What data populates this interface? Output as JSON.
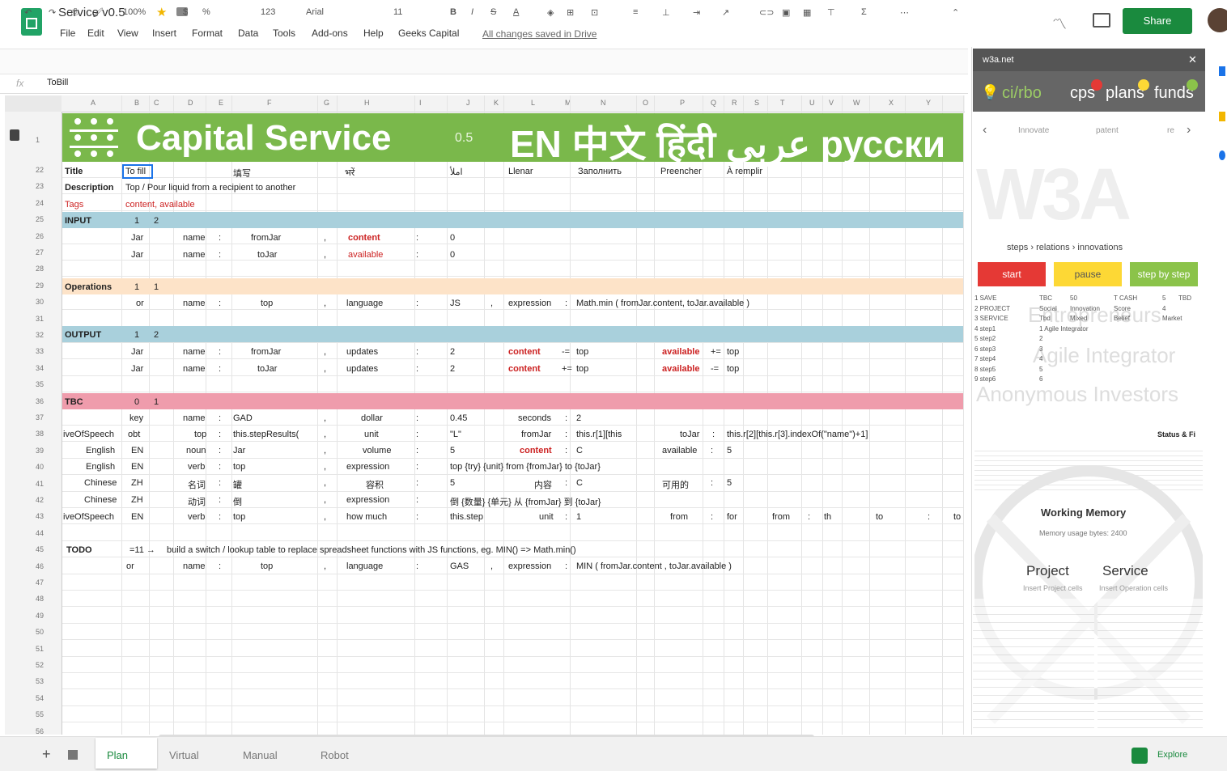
{
  "app": {
    "doc_title": "Service v0.5",
    "menu": [
      "File",
      "Edit",
      "View",
      "Insert",
      "Format",
      "Data",
      "Tools",
      "Add-ons",
      "Help",
      "Geeks Capital"
    ],
    "saved_status": "All changes saved in Drive",
    "share_label": "Share"
  },
  "toolbar": {
    "zoom": "100%",
    "font": "Arial",
    "font_size": "11",
    "format_num": "123"
  },
  "formula": {
    "value": "ToBill"
  },
  "banner": {
    "title": "Capital Service",
    "version": "0.5",
    "langs": "EN 中文 हिंदी عربي русски"
  },
  "grid": {
    "col_headers": [
      "A",
      "B",
      "C",
      "D",
      "E",
      "F",
      "G",
      "H",
      "I",
      "J",
      "K",
      "L",
      "M",
      "N",
      "O",
      "P",
      "Q",
      "R",
      "S",
      "T",
      "U",
      "V",
      "W",
      "X",
      "Y"
    ],
    "row_numbers": [
      "1",
      "22",
      "23",
      "24",
      "25",
      "26",
      "27",
      "28",
      "29",
      "30",
      "31",
      "32",
      "33",
      "34",
      "35",
      "36",
      "37",
      "38",
      "39",
      "40",
      "41",
      "42",
      "43",
      "44",
      "45",
      "46",
      "47",
      "48",
      "49",
      "50",
      "51",
      "52",
      "53",
      "54",
      "55",
      "56"
    ],
    "rows": {
      "r22": [
        "Title",
        "To fill",
        "填写",
        "भरें",
        "املأ",
        "Llenar",
        "Заполнить",
        "Preencher",
        "À remplir"
      ],
      "r23": [
        "Description",
        "Top / Pour liquid from a recipient to another"
      ],
      "r24": [
        "Tags",
        "content, available"
      ],
      "r25": [
        "INPUT",
        "1",
        "2"
      ],
      "r26": [
        "Jar",
        "name",
        ":",
        "fromJar",
        ",",
        "content",
        ":",
        "0"
      ],
      "r27": [
        "Jar",
        "name",
        ":",
        "toJar",
        ",",
        "available",
        ":",
        "0"
      ],
      "r29": [
        "Operations",
        "1",
        "1"
      ],
      "r30": [
        "or",
        "name",
        ":",
        "top",
        ",",
        "language",
        ":",
        "JS",
        ",",
        "expression",
        ":",
        "Math.min ( fromJar.content, toJar.available )"
      ],
      "r32": [
        "OUTPUT",
        "1",
        "2"
      ],
      "r33": [
        "Jar",
        "name",
        ":",
        "fromJar",
        ",",
        "updates",
        ":",
        "2",
        "content",
        "-=",
        "top",
        "available",
        "+=",
        "top"
      ],
      "r34": [
        "Jar",
        "name",
        ":",
        "toJar",
        ",",
        "updates",
        ":",
        "2",
        "content",
        "+=",
        "top",
        "available",
        "-=",
        "top"
      ],
      "r36": [
        "TBC",
        "0",
        "1"
      ],
      "r37": [
        "key",
        "name",
        ":",
        "GAD",
        ",",
        "dollar",
        ":",
        "0.45",
        "seconds",
        ":",
        "2"
      ],
      "r38": [
        "iveOfSpeech",
        "obt",
        "top",
        ":",
        "this.stepResults(",
        ",",
        "unit",
        ":",
        "\"L\"",
        "fromJar",
        ":",
        "this.r[1][this",
        "toJar",
        ":",
        "this.r[2][this.r[3].indexOf(\"name\")+1]"
      ],
      "r39": [
        "English",
        "EN",
        "noun",
        ":",
        "Jar",
        ",",
        "volume",
        ":",
        "5",
        "content",
        ":",
        "C",
        "available",
        ":",
        "5"
      ],
      "r40": [
        "English",
        "EN",
        "verb",
        ":",
        "top",
        ",",
        "expression",
        ":",
        "top {try} {unit} from {fromJar} to {toJar}"
      ],
      "r41": [
        "Chinese",
        "ZH",
        "名词",
        ":",
        "罐",
        ",",
        "容积",
        ":",
        "5",
        "内容",
        ":",
        "C",
        "可用的",
        ":",
        "5"
      ],
      "r42": [
        "Chinese",
        "ZH",
        "动词",
        ":",
        "倒",
        ",",
        "expression",
        ":",
        "倒 {数量} {单元} 从 {fromJar} 到 {toJar}"
      ],
      "r43": [
        "iveOfSpeech",
        "EN",
        "verb",
        ":",
        "top",
        ",",
        "how much",
        ":",
        "this.step",
        "unit",
        ":",
        "1",
        "from",
        ":",
        "for",
        "from",
        ":",
        "th",
        "to",
        ":",
        "to"
      ],
      "r45": [
        "TODO",
        "=11 →",
        "build a switch / lookup table to replace spreadsheet functions with JS functions, eg. MIN() => Math.min()"
      ],
      "r46": [
        "or",
        "name",
        ":",
        "top",
        ",",
        "language",
        ":",
        "GAS",
        ",",
        "expression",
        ":",
        "MIN ( fromJar.content , toJar.available )"
      ]
    }
  },
  "sidebar": {
    "header": "w3a.net",
    "tabs": [
      "ci/rbo",
      "cps",
      "plans",
      "funds"
    ],
    "nav_items": [
      "Innovate",
      "patent",
      "re"
    ],
    "watermark_text": "W3A",
    "steps_crumb": "steps › relations › innovations",
    "buttons": {
      "start": "start",
      "pause": "pause",
      "step": "step by step"
    },
    "mini_rows": [
      [
        "1 SAVE",
        "TBC",
        "50",
        "T CASH",
        "5",
        "TBD"
      ],
      [
        "2 PROJECT",
        "Social",
        "Innovation",
        "Score",
        "4",
        ""
      ],
      [
        "3 SERVICE",
        "Tbd",
        "Mixed",
        "Belief",
        "Market",
        ""
      ],
      [
        "4 step1",
        "1 Agile Integrator",
        "",
        "",
        "",
        ""
      ],
      [
        "5 step2",
        "2",
        "",
        "",
        "",
        ""
      ],
      [
        "6 step3",
        "3",
        "",
        "",
        "",
        ""
      ],
      [
        "7 step4",
        "4",
        "",
        "",
        "",
        ""
      ],
      [
        "8 step5",
        "5",
        "",
        "",
        "",
        ""
      ],
      [
        "9 step6",
        "6",
        "",
        "",
        "",
        ""
      ]
    ],
    "overlay_words": [
      "Entrepreneurs",
      "Agile Integrator",
      "Anonymous Investors"
    ],
    "status_label": "Status & Fi",
    "working_memory": "Working Memory",
    "memory_usage": "Memory usage bytes: 2400",
    "project_label": "Project",
    "project_sub": "Insert Project cells",
    "service_label": "Service",
    "service_sub": "Insert Operation cells"
  },
  "bottom": {
    "sheets": [
      "Plan",
      "Virtual",
      "Manual",
      "Robot"
    ],
    "active_sheet": "Plan",
    "explore_label": "Explore"
  },
  "colors": {
    "banner": "#7ab84b",
    "blue_band": "#a9d0dc",
    "orange_band": "#fde3c8",
    "pink_band": "#ef9cac",
    "share": "#1a8a3e",
    "start": "#e53935",
    "pause": "#fdd835",
    "step": "#8bc34a"
  }
}
